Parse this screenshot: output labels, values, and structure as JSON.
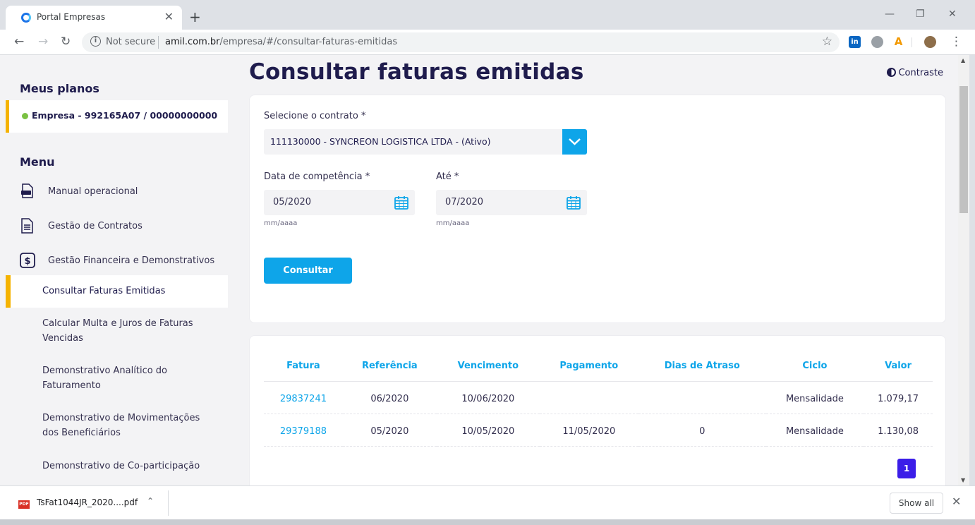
{
  "browser": {
    "tab_title": "Portal Empresas",
    "tab_close": "✕",
    "new_tab": "+",
    "win_min": "—",
    "win_max": "❐",
    "win_close": "✕",
    "back": "←",
    "forward": "→",
    "reload": "↻",
    "info": "i",
    "not_secure": "Not secure",
    "url_host": "amil.com.br",
    "url_path": "/empresa/#/consultar-faturas-emitidas",
    "star": "☆",
    "ext_linkedin": "in",
    "ext_a": "A",
    "menu": "⋮"
  },
  "sidebar": {
    "plans_heading": "Meus planos",
    "plan_label": "Empresa - 992165A07 / 00000000000",
    "menu_heading": "Menu",
    "items": [
      {
        "label": "Manual operacional",
        "icon": "pdf-icon"
      },
      {
        "label": "Gestão de Contratos",
        "icon": "document-icon"
      },
      {
        "label": "Gestão Financeira e Demonstrativos",
        "icon": "dollar-icon"
      }
    ],
    "subitems": [
      {
        "label": "Consultar Faturas Emitidas",
        "active": true
      },
      {
        "label": "Calcular Multa e Juros de Faturas Vencidas",
        "active": false
      },
      {
        "label": "Demonstrativo Analítico do Faturamento",
        "active": false
      },
      {
        "label": "Demonstrativo de Movimentações dos Beneficiários",
        "active": false
      },
      {
        "label": "Demonstrativo de Co-participação",
        "active": false
      }
    ]
  },
  "main": {
    "title": "Consultar faturas emitidas",
    "contrast_label": "Contraste",
    "form": {
      "contract_label": "Selecione o contrato *",
      "contract_value": "111130000 - SYNCREON LOGISTICA LTDA - (Ativo)",
      "date_from_label": "Data de competência *",
      "date_from_value": "05/2020",
      "date_to_label": "Até *",
      "date_to_value": "07/2020",
      "date_hint": "mm/aaaa",
      "submit_label": "Consultar"
    },
    "table": {
      "columns": [
        "Fatura",
        "Referência",
        "Vencimento",
        "Pagamento",
        "Dias de Atraso",
        "Ciclo",
        "Valor"
      ],
      "rows": [
        [
          "29837241",
          "06/2020",
          "10/06/2020",
          "",
          "",
          "Mensalidade",
          "1.079,17"
        ],
        [
          "29379188",
          "05/2020",
          "10/05/2020",
          "11/05/2020",
          "0",
          "Mensalidade",
          "1.130,08"
        ]
      ]
    },
    "pagination": {
      "current_page": "1"
    }
  },
  "downloads": {
    "file_name": "TsFat1044JR_2020....pdf",
    "file_badge": "PDF",
    "chevron": "⌃",
    "show_all": "Show all",
    "close": "✕"
  },
  "colors": {
    "accent": "#0ea5e9",
    "brand_dark": "#1f1c4d",
    "highlight": "#f5b301",
    "page_button": "#3b1de8"
  }
}
